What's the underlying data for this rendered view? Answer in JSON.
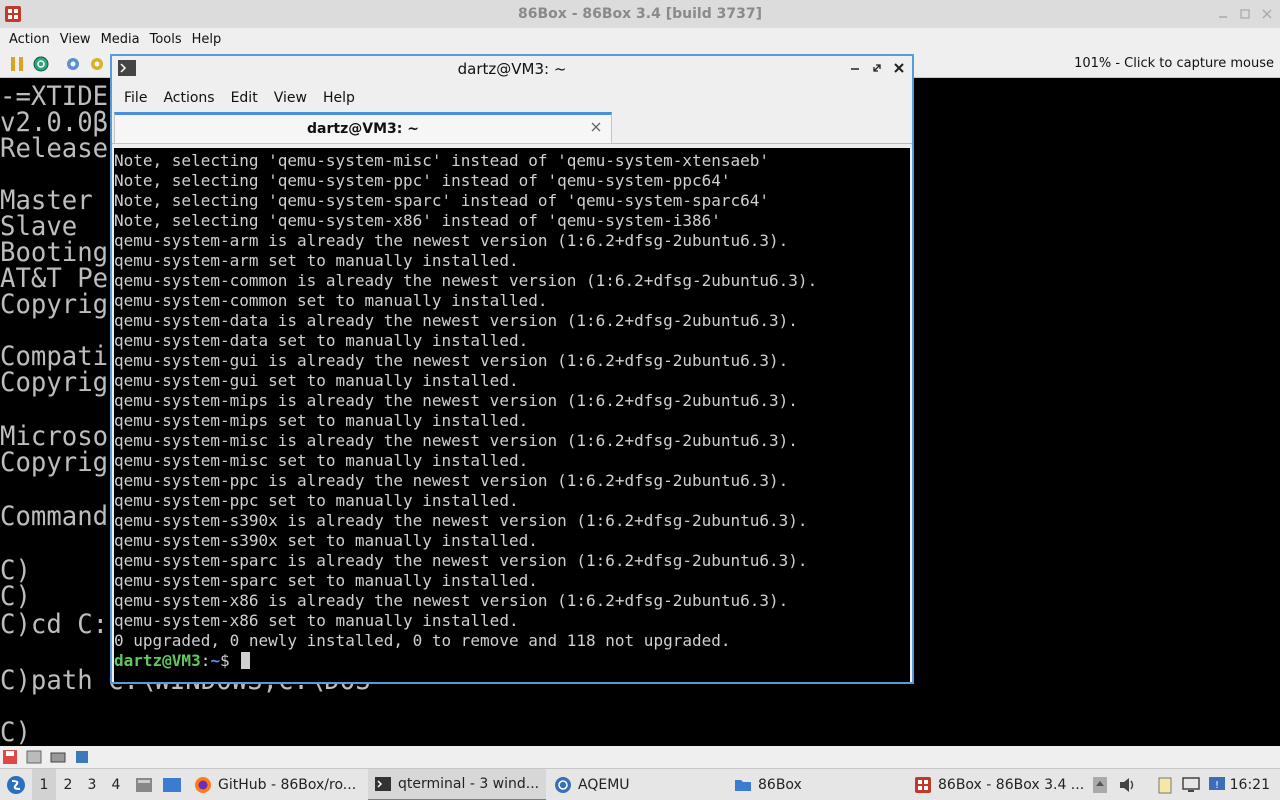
{
  "box": {
    "title": "86Box - 86Box 3.4 [build 3737]",
    "menu": [
      "Action",
      "View",
      "Media",
      "Tools",
      "Help"
    ],
    "capture_hint": "101% - Click to capture mouse",
    "dos_lines": [
      "-=XTIDE",
      "v2.0.0β",
      "Release",
      "",
      "Master",
      "Slave",
      "Booting",
      "AT&T Pe",
      "Copyrig",
      "",
      "Compati",
      "Copyrig",
      "",
      "Microso",
      "Copyrig",
      "",
      "Command",
      "",
      "C)",
      "C)",
      "C)cd C:",
      "",
      "C)path C:\\WINDOWS;C:\\DOS",
      "",
      "C)"
    ]
  },
  "qterminal": {
    "window_title": "dartz@VM3: ~",
    "menu": [
      "File",
      "Actions",
      "Edit",
      "View",
      "Help"
    ],
    "tab_title": "dartz@VM3: ~",
    "output": [
      "Note, selecting 'qemu-system-misc' instead of 'qemu-system-xtensaeb'",
      "Note, selecting 'qemu-system-ppc' instead of 'qemu-system-ppc64'",
      "Note, selecting 'qemu-system-sparc' instead of 'qemu-system-sparc64'",
      "Note, selecting 'qemu-system-x86' instead of 'qemu-system-i386'",
      "qemu-system-arm is already the newest version (1:6.2+dfsg-2ubuntu6.3).",
      "qemu-system-arm set to manually installed.",
      "qemu-system-common is already the newest version (1:6.2+dfsg-2ubuntu6.3).",
      "qemu-system-common set to manually installed.",
      "qemu-system-data is already the newest version (1:6.2+dfsg-2ubuntu6.3).",
      "qemu-system-data set to manually installed.",
      "qemu-system-gui is already the newest version (1:6.2+dfsg-2ubuntu6.3).",
      "qemu-system-gui set to manually installed.",
      "qemu-system-mips is already the newest version (1:6.2+dfsg-2ubuntu6.3).",
      "qemu-system-mips set to manually installed.",
      "qemu-system-misc is already the newest version (1:6.2+dfsg-2ubuntu6.3).",
      "qemu-system-misc set to manually installed.",
      "qemu-system-ppc is already the newest version (1:6.2+dfsg-2ubuntu6.3).",
      "qemu-system-ppc set to manually installed.",
      "qemu-system-s390x is already the newest version (1:6.2+dfsg-2ubuntu6.3).",
      "qemu-system-s390x set to manually installed.",
      "qemu-system-sparc is already the newest version (1:6.2+dfsg-2ubuntu6.3).",
      "qemu-system-sparc set to manually installed.",
      "qemu-system-x86 is already the newest version (1:6.2+dfsg-2ubuntu6.3).",
      "qemu-system-x86 set to manually installed.",
      "0 upgraded, 0 newly installed, 0 to remove and 118 not upgraded."
    ],
    "prompt": {
      "user_host": "dartz@VM3",
      "colon": ":",
      "path": "~",
      "symbol": "$"
    }
  },
  "taskbar": {
    "workspaces": [
      "1",
      "2",
      "3",
      "4"
    ],
    "active_workspace": "1",
    "tasks": [
      {
        "label": "GitHub - 86Box/ro...",
        "icon": "firefox-icon"
      },
      {
        "label": "qterminal - 3 wind...",
        "icon": "terminal-icon"
      },
      {
        "label": "AQEMU",
        "icon": "aqemu-icon"
      },
      {
        "label": "86Box",
        "icon": "folder-icon"
      },
      {
        "label": "86Box - 86Box 3.4 ...",
        "icon": "86box-icon"
      }
    ],
    "clock": "16:21"
  },
  "colors": {
    "accent": "#4a90d9",
    "prompt_user": "#5ec95e",
    "prompt_path": "#5b8fe6"
  }
}
